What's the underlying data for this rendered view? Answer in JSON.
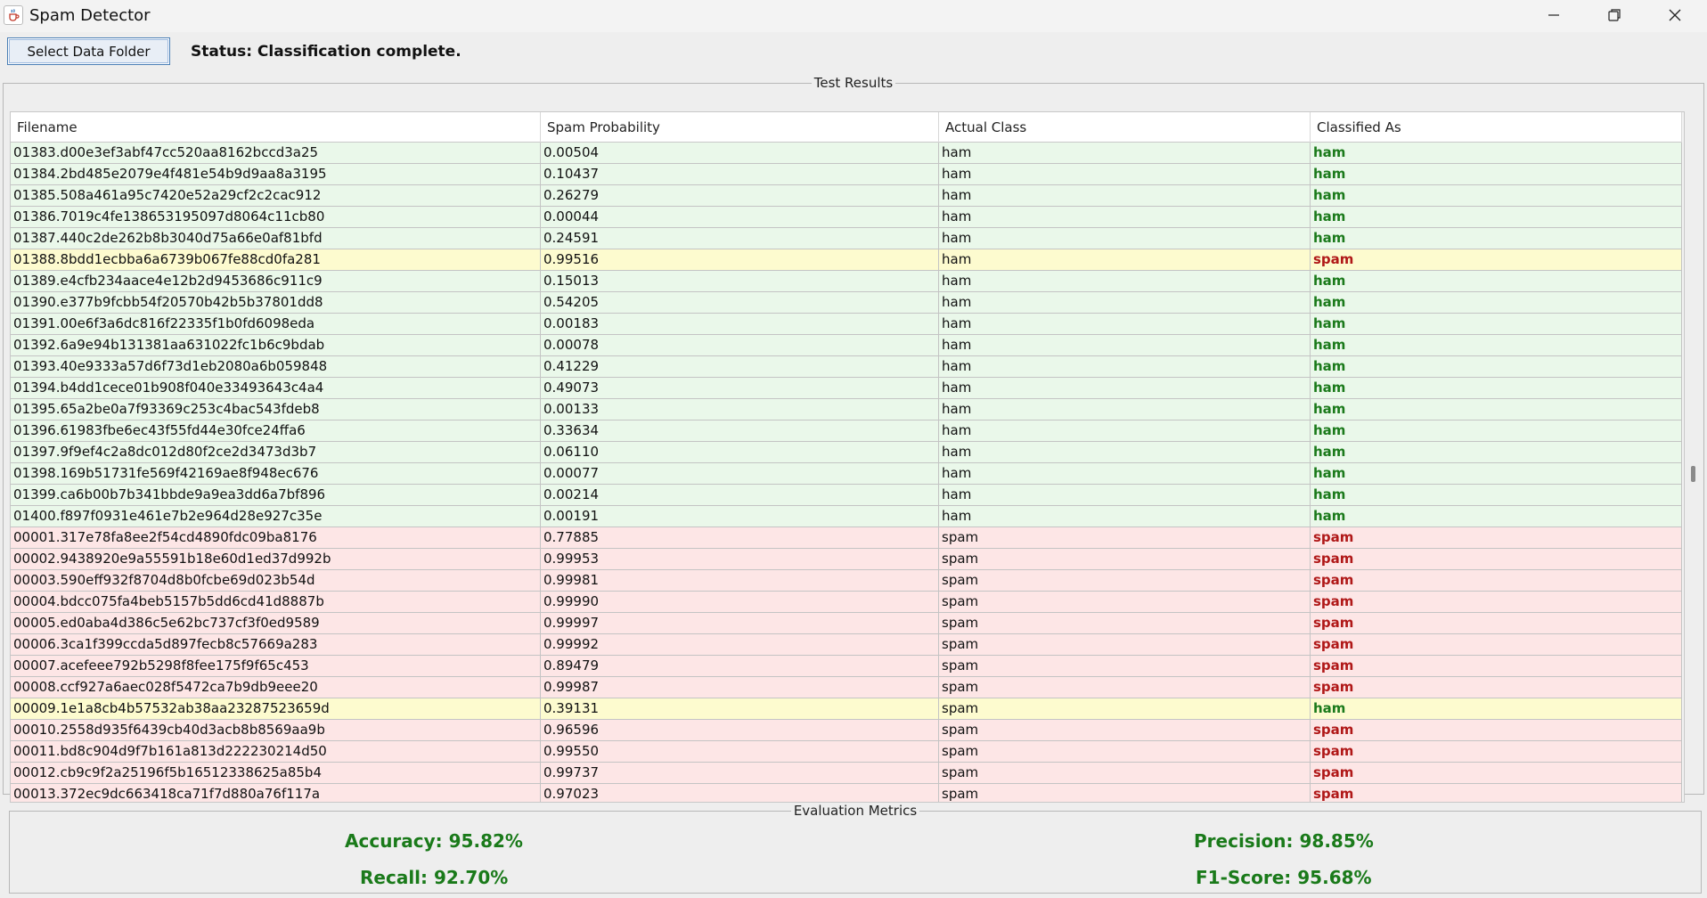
{
  "window": {
    "title": "Spam Detector",
    "icons": [
      "java-cup-icon",
      "minimize-icon",
      "restore-icon",
      "close-icon"
    ]
  },
  "toolbar": {
    "select_label": "Select Data Folder",
    "status": "Status: Classification complete."
  },
  "results": {
    "title": "Test Results",
    "columns": [
      "Filename",
      "Spam Probability",
      "Actual Class",
      "Classified As"
    ],
    "rows": [
      [
        "01383.d00e3ef3abf47cc520aa8162bccd3a25",
        "0.00504",
        "ham",
        "ham"
      ],
      [
        "01384.2bd485e2079e4f481e54b9d9aa8a3195",
        "0.10437",
        "ham",
        "ham"
      ],
      [
        "01385.508a461a95c7420e52a29cf2c2cac912",
        "0.26279",
        "ham",
        "ham"
      ],
      [
        "01386.7019c4fe138653195097d8064c11cb80",
        "0.00044",
        "ham",
        "ham"
      ],
      [
        "01387.440c2de262b8b3040d75a66e0af81bfd",
        "0.24591",
        "ham",
        "ham"
      ],
      [
        "01388.8bdd1ecbba6a6739b067fe88cd0fa281",
        "0.99516",
        "ham",
        "spam"
      ],
      [
        "01389.e4cfb234aace4e12b2d9453686c911c9",
        "0.15013",
        "ham",
        "ham"
      ],
      [
        "01390.e377b9fcbb54f20570b42b5b37801dd8",
        "0.54205",
        "ham",
        "ham"
      ],
      [
        "01391.00e6f3a6dc816f22335f1b0fd6098eda",
        "0.00183",
        "ham",
        "ham"
      ],
      [
        "01392.6a9e94b131381aa631022fc1b6c9bdab",
        "0.00078",
        "ham",
        "ham"
      ],
      [
        "01393.40e9333a57d6f73d1eb2080a6b059848",
        "0.41229",
        "ham",
        "ham"
      ],
      [
        "01394.b4dd1cece01b908f040e33493643c4a4",
        "0.49073",
        "ham",
        "ham"
      ],
      [
        "01395.65a2be0a7f93369c253c4bac543fdeb8",
        "0.00133",
        "ham",
        "ham"
      ],
      [
        "01396.61983fbe6ec43f55fd44e30fce24ffa6",
        "0.33634",
        "ham",
        "ham"
      ],
      [
        "01397.9f9ef4c2a8dc012d80f2ce2d3473d3b7",
        "0.06110",
        "ham",
        "ham"
      ],
      [
        "01398.169b51731fe569f42169ae8f948ec676",
        "0.00077",
        "ham",
        "ham"
      ],
      [
        "01399.ca6b00b7b341bbde9a9ea3dd6a7bf896",
        "0.00214",
        "ham",
        "ham"
      ],
      [
        "01400.f897f0931e461e7b2e964d28e927c35e",
        "0.00191",
        "ham",
        "ham"
      ],
      [
        "00001.317e78fa8ee2f54cd4890fdc09ba8176",
        "0.77885",
        "spam",
        "spam"
      ],
      [
        "00002.9438920e9a55591b18e60d1ed37d992b",
        "0.99953",
        "spam",
        "spam"
      ],
      [
        "00003.590eff932f8704d8b0fcbe69d023b54d",
        "0.99981",
        "spam",
        "spam"
      ],
      [
        "00004.bdcc075fa4beb5157b5dd6cd41d8887b",
        "0.99990",
        "spam",
        "spam"
      ],
      [
        "00005.ed0aba4d386c5e62bc737cf3f0ed9589",
        "0.99997",
        "spam",
        "spam"
      ],
      [
        "00006.3ca1f399ccda5d897fecb8c57669a283",
        "0.99992",
        "spam",
        "spam"
      ],
      [
        "00007.acefeee792b5298f8fee175f9f65c453",
        "0.89479",
        "spam",
        "spam"
      ],
      [
        "00008.ccf927a6aec028f5472ca7b9db9eee20",
        "0.99987",
        "spam",
        "spam"
      ],
      [
        "00009.1e1a8cb4b57532ab38aa23287523659d",
        "0.39131",
        "spam",
        "ham"
      ],
      [
        "00010.2558d935f6439cb40d3acb8b8569aa9b",
        "0.96596",
        "spam",
        "spam"
      ],
      [
        "00011.bd8c904d9f7b161a813d222230214d50",
        "0.99550",
        "spam",
        "spam"
      ],
      [
        "00012.cb9c9f2a25196f5b16512338625a85b4",
        "0.99737",
        "spam",
        "spam"
      ],
      [
        "00013.372ec9dc663418ca71f7d880a76f117a",
        "0.97023",
        "spam",
        "spam"
      ]
    ]
  },
  "metrics": {
    "title": "Evaluation Metrics",
    "accuracy": "Accuracy: 95.82%",
    "precision": "Precision: 98.85%",
    "recall": "Recall: 92.70%",
    "f1": "F1-Score: 95.68%"
  },
  "colors": {
    "ham_bg": "#eaf8ea",
    "spam_bg": "#fde6e6",
    "mismatch_bg": "#fdfbcf",
    "ham_text": "#1b7a1b",
    "spam_text": "#b01818",
    "metric_text": "#1a7a1a"
  }
}
